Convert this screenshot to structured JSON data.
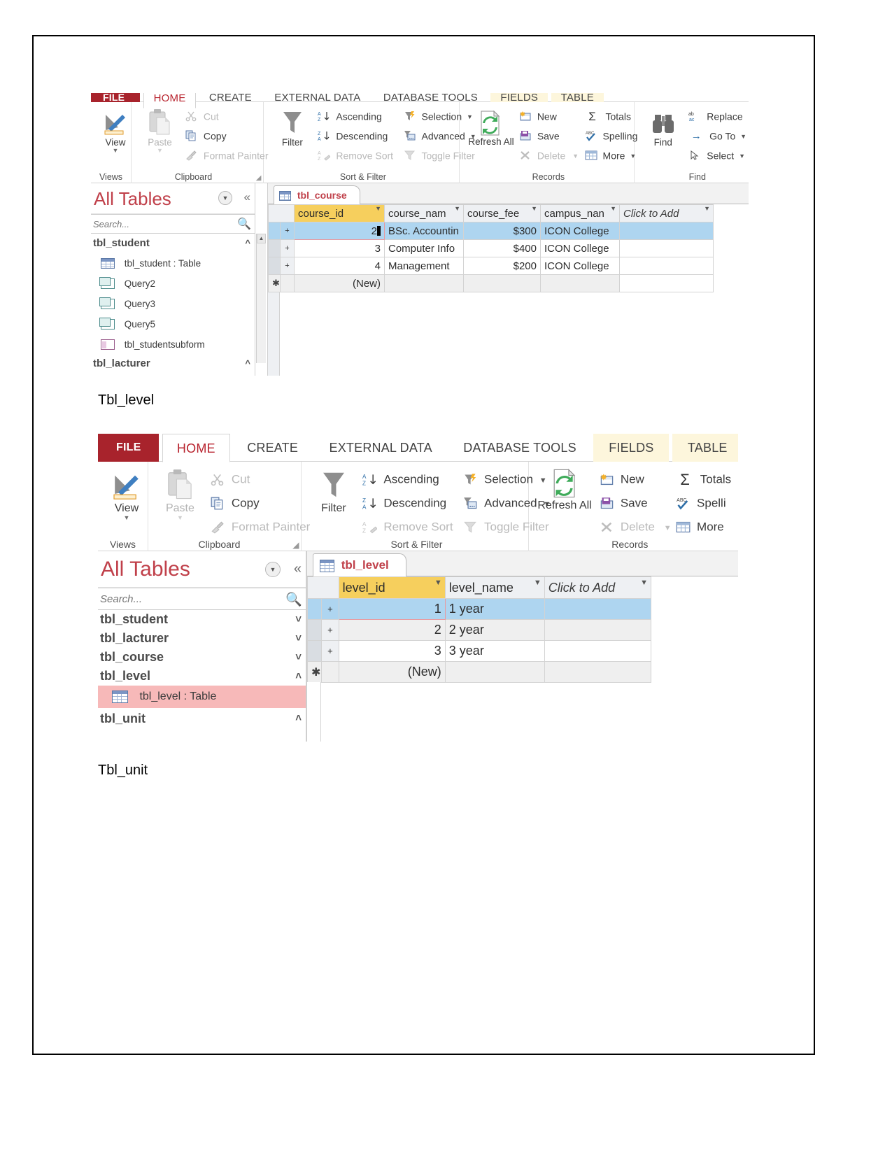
{
  "document": {
    "caption_1": "Tbl_level",
    "caption_2": "Tbl_unit"
  },
  "screenshot_1": {
    "ribbon_tabs": [
      {
        "label": "FILE",
        "kind": "file"
      },
      {
        "label": "HOME",
        "kind": "active"
      },
      {
        "label": "CREATE",
        "kind": "normal"
      },
      {
        "label": "EXTERNAL DATA",
        "kind": "normal"
      },
      {
        "label": "DATABASE TOOLS",
        "kind": "normal"
      },
      {
        "label": "FIELDS",
        "kind": "context"
      },
      {
        "label": "TABLE",
        "kind": "context"
      }
    ],
    "groups": {
      "views": {
        "label": "Views",
        "button": "View"
      },
      "clipboard": {
        "label": "Clipboard",
        "paste": "Paste",
        "items": [
          "Cut",
          "Copy",
          "Format Painter"
        ]
      },
      "sort_filter": {
        "label": "Sort & Filter",
        "filter": "Filter",
        "col1": [
          "Ascending",
          "Descending",
          "Remove Sort"
        ],
        "col2": [
          "Selection",
          "Advanced",
          "Toggle Filter"
        ]
      },
      "records": {
        "label": "Records",
        "refresh": "Refresh All",
        "col1": [
          "New",
          "Save",
          "Delete"
        ],
        "col2": [
          "Totals",
          "Spelling",
          "More"
        ]
      },
      "find": {
        "label": "Find",
        "find": "Find",
        "items": [
          "Replace",
          "Go To",
          "Select"
        ]
      }
    },
    "nav": {
      "title": "All Tables",
      "search_placeholder": "Search...",
      "search_value": "",
      "groups": [
        {
          "name": "tbl_student",
          "state": "expanded",
          "objects": [
            {
              "label": "tbl_student : Table",
              "icon": "table-icon"
            },
            {
              "label": "Query2",
              "icon": "query-icon"
            },
            {
              "label": "Query3",
              "icon": "query-icon"
            },
            {
              "label": "Query5",
              "icon": "query-icon"
            },
            {
              "label": "tbl_studentsubform",
              "icon": "form-icon"
            }
          ]
        },
        {
          "name": "tbl_lacturer",
          "state": "expanded",
          "objects": []
        }
      ]
    },
    "datasheet": {
      "tab_label": "tbl_course",
      "columns": [
        "course_id",
        "course_nam",
        "course_fee",
        "campus_nan",
        "Click to Add"
      ],
      "rows": [
        {
          "course_id": "2",
          "course_nam": "BSc. Accountin",
          "course_fee": "$300",
          "campus_nan": "ICON College",
          "selected": true,
          "editing": true
        },
        {
          "course_id": "3",
          "course_nam": "Computer Info",
          "course_fee": "$400",
          "campus_nan": "ICON College",
          "selected": false,
          "editing": false
        },
        {
          "course_id": "4",
          "course_nam": "Management",
          "course_fee": "$200",
          "campus_nan": "ICON College",
          "selected": false,
          "editing": false
        }
      ],
      "new_row_label": "(New)"
    }
  },
  "screenshot_2": {
    "ribbon_tabs": [
      {
        "label": "FILE",
        "kind": "file"
      },
      {
        "label": "HOME",
        "kind": "active"
      },
      {
        "label": "CREATE",
        "kind": "normal"
      },
      {
        "label": "EXTERNAL DATA",
        "kind": "normal"
      },
      {
        "label": "DATABASE TOOLS",
        "kind": "normal"
      },
      {
        "label": "FIELDS",
        "kind": "context"
      },
      {
        "label": "TABLE",
        "kind": "context"
      }
    ],
    "groups": {
      "views": {
        "label": "Views",
        "button": "View"
      },
      "clipboard": {
        "label": "Clipboard",
        "paste": "Paste",
        "items": [
          "Cut",
          "Copy",
          "Format Painter"
        ]
      },
      "sort_filter": {
        "label": "Sort & Filter",
        "filter": "Filter",
        "col1": [
          "Ascending",
          "Descending",
          "Remove Sort"
        ],
        "col2": [
          "Selection",
          "Advanced",
          "Toggle Filter"
        ]
      },
      "records": {
        "label": "Records",
        "refresh": "Refresh All",
        "col1": [
          "New",
          "Save",
          "Delete"
        ],
        "col2": [
          "Totals",
          "Spelli",
          "More"
        ]
      }
    },
    "nav": {
      "title": "All Tables",
      "search_placeholder": "Search...",
      "search_value": "",
      "groups": [
        {
          "name": "tbl_student",
          "state": "collapsed",
          "objects": []
        },
        {
          "name": "tbl_lacturer",
          "state": "collapsed",
          "objects": []
        },
        {
          "name": "tbl_course",
          "state": "collapsed",
          "objects": []
        },
        {
          "name": "tbl_level",
          "state": "expanded",
          "objects": [
            {
              "label": "tbl_level : Table",
              "icon": "table-icon",
              "selected": true
            }
          ]
        },
        {
          "name": "tbl_unit",
          "state": "expanded",
          "objects": []
        }
      ]
    },
    "datasheet": {
      "tab_label": "tbl_level",
      "columns": [
        "level_id",
        "level_name",
        "Click to Add"
      ],
      "rows": [
        {
          "level_id": "1",
          "level_name": "1 year",
          "selected": true,
          "editing": true
        },
        {
          "level_id": "2",
          "level_name": "2 year",
          "selected": false,
          "editing": false
        },
        {
          "level_id": "3",
          "level_name": "3 year",
          "selected": false,
          "editing": false
        }
      ],
      "new_row_label": "(New)"
    }
  },
  "colors": {
    "file_tab": "#a8232c",
    "accent_red": "#c0404a",
    "key_header": "#f6cf5d",
    "row_highlight": "#aed5f0",
    "nav_selected": "#f7b9b9"
  }
}
